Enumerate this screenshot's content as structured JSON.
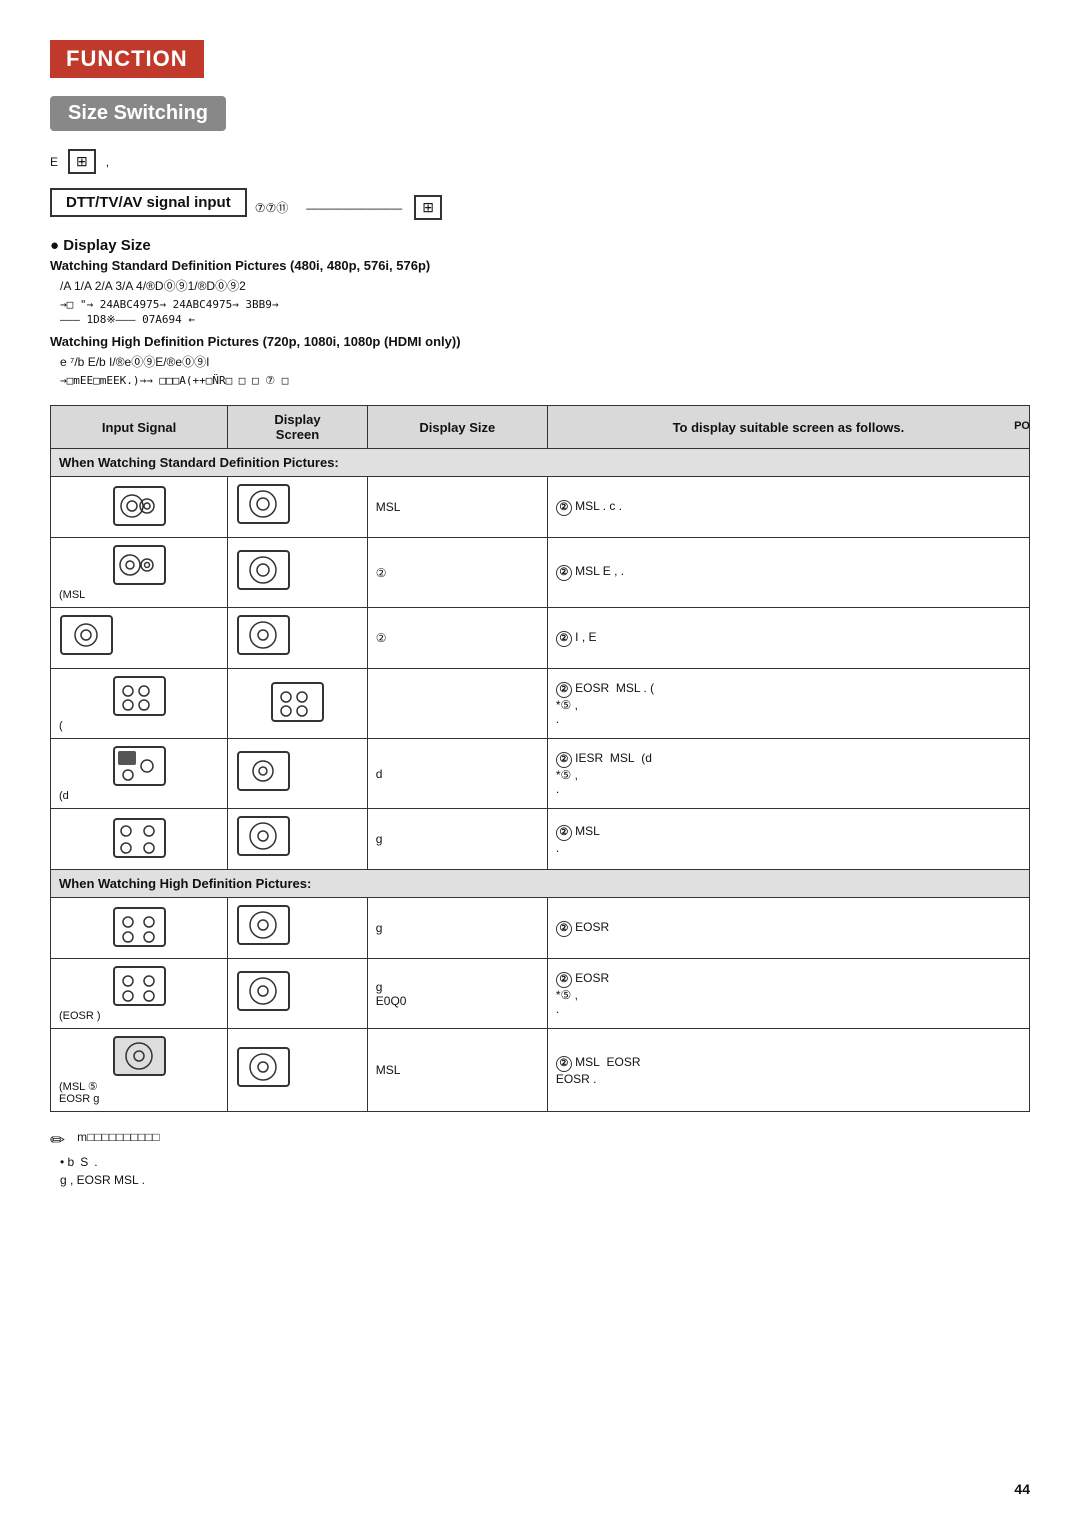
{
  "header": {
    "function_label": "FUNCTION",
    "size_switching_label": "Size Switching"
  },
  "top_info": {
    "prefix": "E",
    "suffix": ","
  },
  "signal_input": {
    "label": "DTT/TV/AV signal input"
  },
  "display_size_section": {
    "title": "Display Size",
    "standard_def_title": "Watching Standard Definition Pictures (480i, 480p, 576i, 576p)",
    "standard_def_line1": "/A 1/A  2/A  3/A  4/®D⓪⑨1/®D⓪⑨2",
    "standard_def_arrow1": "→□ \"→ 24ABC4975→ 24ABC4975→ 3BB9→",
    "standard_def_arrow2": "——— 1D8※——— 07A694 ←",
    "high_def_title": "Watching High Definition Pictures (720p, 1080i, 1080p (HDMI only))",
    "high_def_line1": "e  ⁷/b  E/b  I/®e⓪⑨E/®e⓪⑨I",
    "high_def_arrow": "→□mEE□mEEK.)→→   □□□A(++□N̈R□     □       □     ⑦  □"
  },
  "table": {
    "headers": [
      "Input Signal",
      "Display\nScreen",
      "Display Size",
      "To display suitable screen as follows."
    ],
    "standard_section": "When Watching Standard Definition Pictures:",
    "high_def_section": "When Watching High Definition Pictures:",
    "rows": [
      {
        "group": "standard",
        "input_label": "",
        "display_size": "MSL",
        "info": "② MSL . c ."
      },
      {
        "group": "standard",
        "input_label": "(MSL",
        "display_size": "②",
        "info": "② MSL E , ."
      },
      {
        "group": "standard",
        "input_label": "",
        "display_size": "②",
        "info": "② I , E"
      },
      {
        "group": "standard",
        "input_label": "(",
        "display_size": "",
        "info": "② EOSR  MSL . ( *⑤ , ."
      },
      {
        "group": "standard",
        "input_label": "(d",
        "display_size": "d",
        "info": "② IESR  MSL (d *⑤ , ."
      },
      {
        "group": "standard",
        "input_label": "",
        "display_size": "g",
        "info": "② MSL ."
      },
      {
        "group": "high",
        "input_label": "",
        "display_size": "g",
        "info": "② EOSR"
      },
      {
        "group": "high",
        "input_label": "(EOSR  )",
        "display_size": "g",
        "info": "② EOSR E0Q0 *⑤ , ."
      },
      {
        "group": "high",
        "input_label": "(MSL ⑤\nEOSR g",
        "display_size": "MSL",
        "info": "② MSL EOSR EOSR ."
      }
    ]
  },
  "notes": {
    "note_icon": "✎",
    "note_prefix": "m□□□□□□□□□□",
    "bullet1_prefix": "• b",
    "bullet1_suffix": "S",
    "bullet1_line2": "g , EOSR  MSL ."
  },
  "page_number": "44",
  "po_label": "PO"
}
